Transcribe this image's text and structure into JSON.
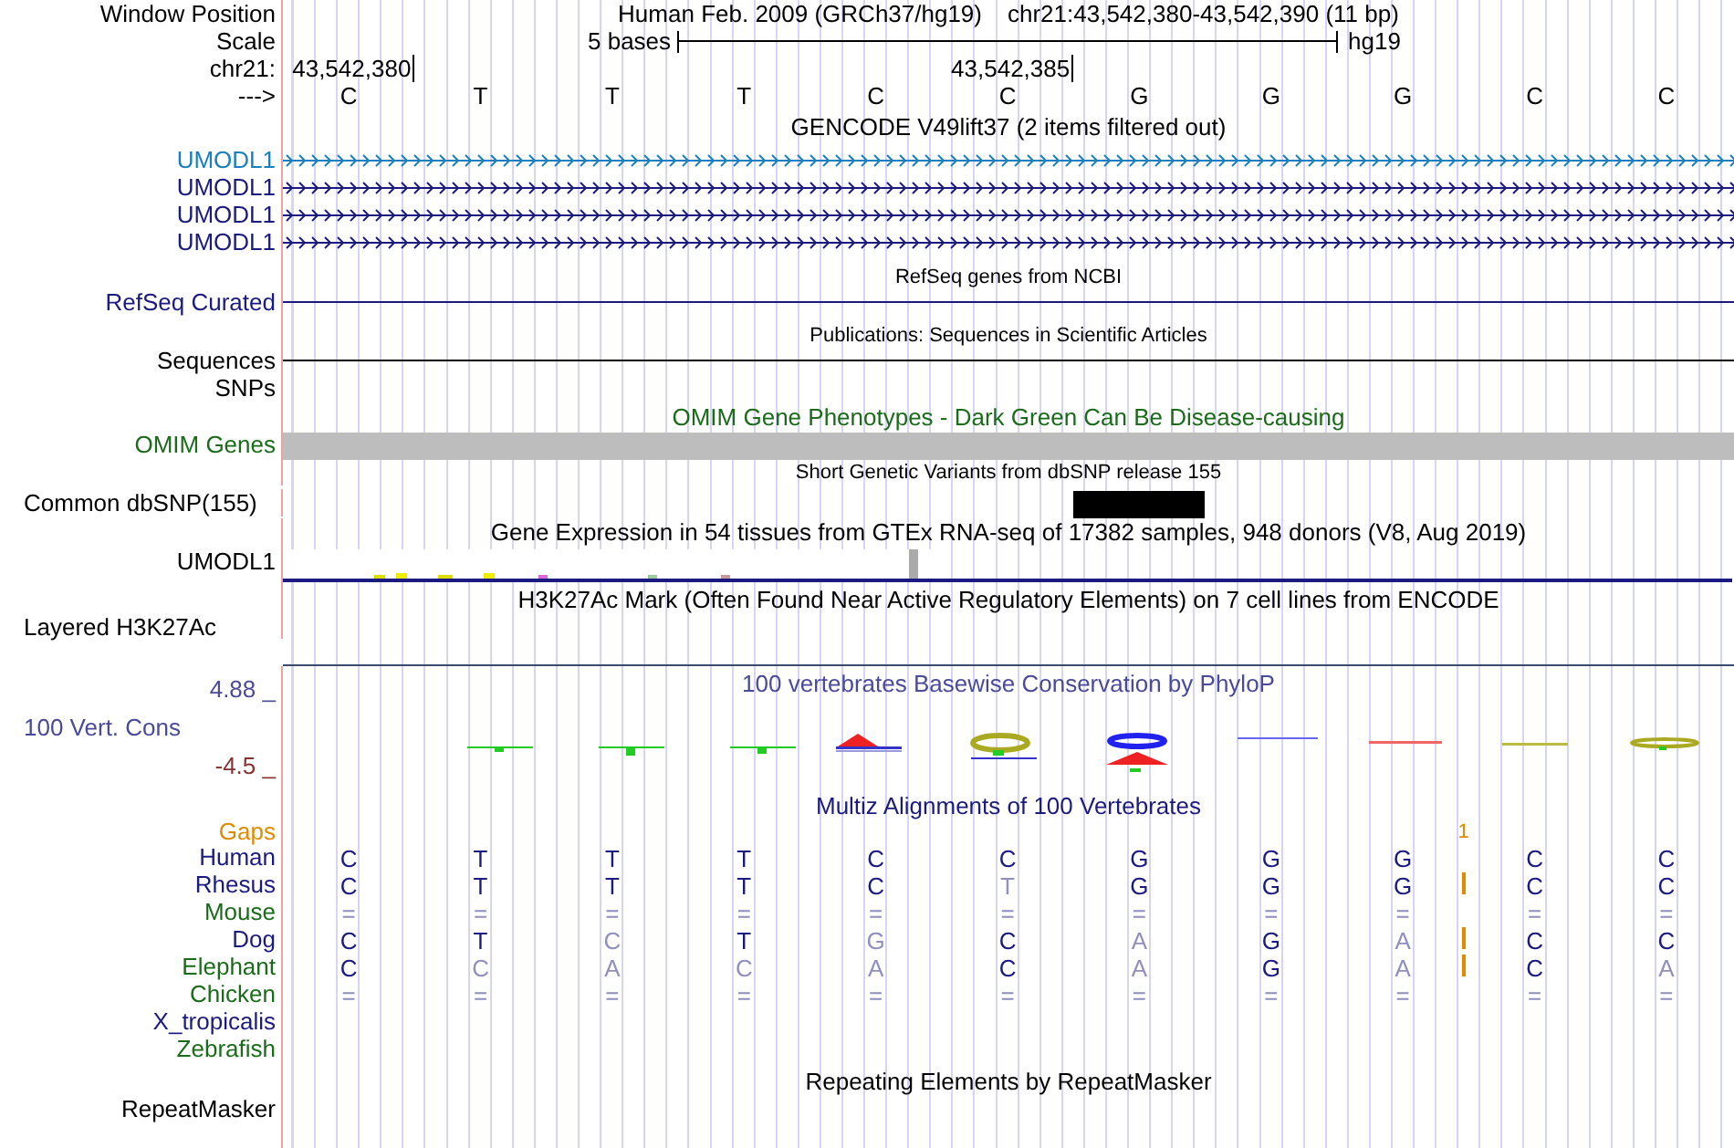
{
  "position": {
    "label": "Window Position",
    "title": "Human Feb. 2009 (GRCh37/hg19)",
    "range": "chr21:43,542,380-43,542,390 (11 bp)"
  },
  "scale": {
    "label": "Scale",
    "length": "5 bases",
    "assembly": "hg19"
  },
  "coordinates": {
    "label": "chr21:",
    "ticks": [
      "43,542,380",
      "43,542,385"
    ]
  },
  "sequence": {
    "label": "--->",
    "bases": [
      "C",
      "T",
      "T",
      "T",
      "C",
      "C",
      "G",
      "G",
      "G",
      "C",
      "C"
    ]
  },
  "gencode": {
    "title": "GENCODE V49lift37 (2 items filtered out)",
    "transcripts": [
      {
        "name": "UMODL1",
        "color": "#1a7fc0"
      },
      {
        "name": "UMODL1",
        "color": "#1a1a80"
      },
      {
        "name": "UMODL1",
        "color": "#1a1a80"
      },
      {
        "name": "UMODL1",
        "color": "#1a1a80"
      }
    ]
  },
  "refseq": {
    "title": "RefSeq genes from NCBI",
    "label": "RefSeq Curated"
  },
  "publications": {
    "title": "Publications: Sequences in Scientific Articles",
    "label": "Sequences"
  },
  "snps": {
    "label": "SNPs"
  },
  "omim": {
    "title": "OMIM Gene Phenotypes - Dark Green Can Be Disease-causing",
    "label": "OMIM Genes"
  },
  "dbsnp": {
    "title": "Short Genetic Variants from dbSNP release 155",
    "label": "Common dbSNP(155)"
  },
  "gtex": {
    "title": "Gene Expression in 54 tissues from GTEx RNA-seq of 17382 samples, 948 donors (V8, Aug 2019)",
    "label": "UMODL1"
  },
  "h3k27ac": {
    "title": "H3K27Ac Mark (Often Found Near Active Regulatory Elements) on 7 cell lines from ENCODE",
    "label": "Layered H3K27Ac"
  },
  "conservation": {
    "title": "100 vertebrates Basewise Conservation by PhyloP",
    "label": "100 Vert. Cons",
    "max": "4.88 _",
    "min": "-4.5 _"
  },
  "multiz": {
    "title": "Multiz Alignments of 100 Vertebrates",
    "gaps_label": "Gaps",
    "gap_count": "1",
    "species": [
      {
        "name": "Human",
        "color": "#1a1a80",
        "gap": false,
        "bases": [
          {
            "b": "C",
            "match": true
          },
          {
            "b": "T",
            "match": true
          },
          {
            "b": "T",
            "match": true
          },
          {
            "b": "T",
            "match": true
          },
          {
            "b": "C",
            "match": true
          },
          {
            "b": "C",
            "match": true
          },
          {
            "b": "G",
            "match": true
          },
          {
            "b": "G",
            "match": true
          },
          {
            "b": "G",
            "match": true
          },
          {
            "b": "C",
            "match": true
          },
          {
            "b": "C",
            "match": true
          }
        ]
      },
      {
        "name": "Rhesus",
        "color": "#1a1a80",
        "gap": true,
        "bases": [
          {
            "b": "C",
            "match": true
          },
          {
            "b": "T",
            "match": true
          },
          {
            "b": "T",
            "match": true
          },
          {
            "b": "T",
            "match": true
          },
          {
            "b": "C",
            "match": true
          },
          {
            "b": "T",
            "match": false
          },
          {
            "b": "G",
            "match": true
          },
          {
            "b": "G",
            "match": true
          },
          {
            "b": "G",
            "match": true
          },
          {
            "b": "C",
            "match": true
          },
          {
            "b": "C",
            "match": true
          }
        ]
      },
      {
        "name": "Mouse",
        "color": "#1a6b1a",
        "gap": false,
        "bases": [
          {
            "b": "=",
            "match": false
          },
          {
            "b": "=",
            "match": false
          },
          {
            "b": "=",
            "match": false
          },
          {
            "b": "=",
            "match": false
          },
          {
            "b": "=",
            "match": false
          },
          {
            "b": "=",
            "match": false
          },
          {
            "b": "=",
            "match": false
          },
          {
            "b": "=",
            "match": false
          },
          {
            "b": "=",
            "match": false
          },
          {
            "b": "=",
            "match": false
          },
          {
            "b": "=",
            "match": false
          }
        ]
      },
      {
        "name": "Dog",
        "color": "#1a1a80",
        "gap": true,
        "bases": [
          {
            "b": "C",
            "match": true
          },
          {
            "b": "T",
            "match": true
          },
          {
            "b": "C",
            "match": false
          },
          {
            "b": "T",
            "match": true
          },
          {
            "b": "G",
            "match": false
          },
          {
            "b": "C",
            "match": true
          },
          {
            "b": "A",
            "match": false
          },
          {
            "b": "G",
            "match": true
          },
          {
            "b": "A",
            "match": false
          },
          {
            "b": "C",
            "match": true
          },
          {
            "b": "C",
            "match": true
          }
        ]
      },
      {
        "name": "Elephant",
        "color": "#1a6b1a",
        "gap": true,
        "bases": [
          {
            "b": "C",
            "match": true
          },
          {
            "b": "C",
            "match": false
          },
          {
            "b": "A",
            "match": false
          },
          {
            "b": "C",
            "match": false
          },
          {
            "b": "A",
            "match": false
          },
          {
            "b": "C",
            "match": true
          },
          {
            "b": "A",
            "match": false
          },
          {
            "b": "G",
            "match": true
          },
          {
            "b": "A",
            "match": false
          },
          {
            "b": "C",
            "match": true
          },
          {
            "b": "A",
            "match": false
          }
        ]
      },
      {
        "name": "Chicken",
        "color": "#1a6b1a",
        "gap": false,
        "bases": [
          {
            "b": "=",
            "match": false
          },
          {
            "b": "=",
            "match": false
          },
          {
            "b": "=",
            "match": false
          },
          {
            "b": "=",
            "match": false
          },
          {
            "b": "=",
            "match": false
          },
          {
            "b": "=",
            "match": false
          },
          {
            "b": "=",
            "match": false
          },
          {
            "b": "=",
            "match": false
          },
          {
            "b": "=",
            "match": false
          },
          {
            "b": "=",
            "match": false
          },
          {
            "b": "=",
            "match": false
          }
        ]
      },
      {
        "name": "X_tropicalis",
        "color": "#1a1a80",
        "gap": false
      },
      {
        "name": "Zebrafish",
        "color": "#1a6b1a",
        "gap": false
      }
    ]
  },
  "repeatmasker": {
    "title": "Repeating Elements by RepeatMasker",
    "label": "RepeatMasker"
  }
}
